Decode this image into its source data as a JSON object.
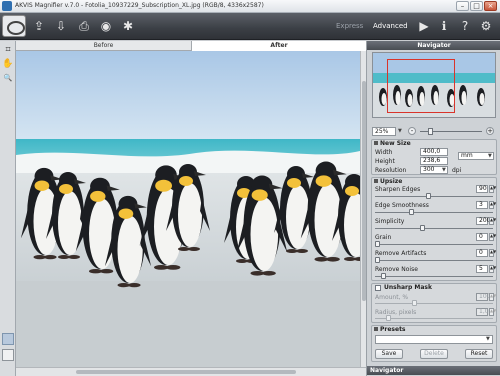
{
  "window": {
    "title": "AKVIS Magnifier v.7.0 - Fotolia_10937229_Subscription_XL.jpg (RGB/8, 4336x2587)",
    "minimize_glyph": "–",
    "maximize_glyph": "□",
    "close_glyph": "×"
  },
  "toolbar": {
    "icons": [
      "open-file-icon",
      "save-file-icon",
      "print-icon",
      "export-icon",
      "settings-gear-icon"
    ],
    "glyphs": {
      "open": "⇪",
      "save": "⇩",
      "print": "⎙",
      "export": "◉",
      "batch": "✱",
      "run": "▶",
      "info": "ℹ",
      "help": "?",
      "prefs": "⚙"
    },
    "mode_express": "Express",
    "mode_advanced": "Advanced"
  },
  "tools": {
    "crop": "⌗",
    "hand": "✋",
    "zoom": "🔍"
  },
  "tabs": {
    "before": "Before",
    "after": "After"
  },
  "navigator": {
    "title": "Navigator",
    "zoom_value": "25%",
    "zoom_minus": "-",
    "zoom_plus": "+"
  },
  "new_size": {
    "title": "New Size",
    "width_label": "Width",
    "width_value": "400,0",
    "height_label": "Height",
    "height_value": "238,6",
    "resolution_label": "Resolution",
    "resolution_value": "300",
    "units": "mm",
    "res_units": "dpi"
  },
  "upsize": {
    "title": "Upsize",
    "sharpen_label": "Sharpen Edges",
    "sharpen_value": "90",
    "sharpen_level": 0.45,
    "edge_label": "Edge Smoothness",
    "edge_value": "3",
    "edge_level": 0.3,
    "simplicity_label": "Simplicity",
    "simplicity_value": "200",
    "simplicity_level": 0.4,
    "grain_label": "Grain",
    "grain_value": "0",
    "grain_level": 0.0,
    "artifacts_label": "Remove Artifacts",
    "artifacts_value": "0",
    "artifacts_level": 0.0,
    "noise_label": "Remove Noise",
    "noise_value": "5",
    "noise_level": 0.05
  },
  "unsharp": {
    "title": "Unsharp Mask",
    "checked": false,
    "amount_label": "Amount, %",
    "amount_value": "100",
    "amount_level": 0.33,
    "radius_label": "Radius, pixels",
    "radius_value": "1,0",
    "radius_level": 0.1
  },
  "presets": {
    "title": "Presets",
    "save_label": "Save",
    "delete_label": "Delete",
    "reset_label": "Reset"
  },
  "footer": {
    "navigator_label": "Navigator"
  }
}
